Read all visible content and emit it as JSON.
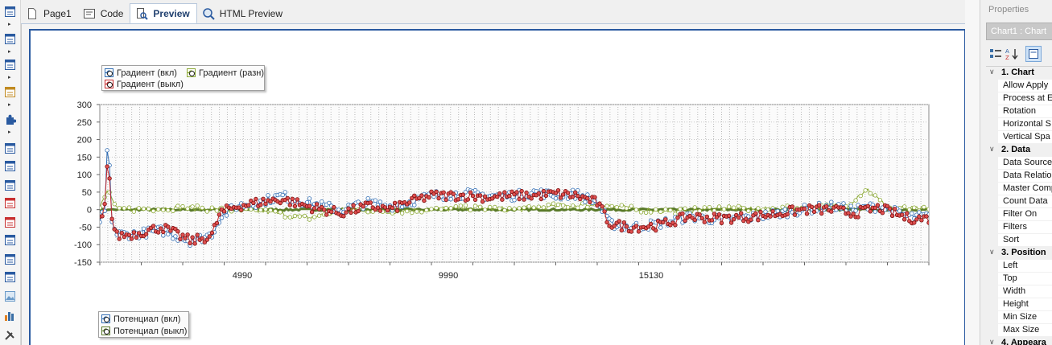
{
  "tabs": [
    {
      "label": "Page1",
      "icon": "page-icon",
      "active": false
    },
    {
      "label": "Code",
      "icon": "code-icon",
      "active": false
    },
    {
      "label": "Preview",
      "icon": "preview-icon",
      "active": true
    },
    {
      "label": "HTML Preview",
      "icon": "html-preview-icon",
      "active": false
    }
  ],
  "toolbox": {
    "icons": [
      "page-layout-icon",
      "data-band-icon",
      "table-band-icon",
      "chart-report-icon",
      "component-icon",
      "text-icon",
      "rich-text-icon",
      "barcode-icon",
      "text-box-icon",
      "header-band-icon",
      "footer-band-icon",
      "crosstab-icon",
      "text-format-icon",
      "image-icon",
      "bar-chart-icon",
      "tools-icon"
    ]
  },
  "properties": {
    "title": "Properties",
    "object": "Chart1 : Chart",
    "toolbar_icons": [
      "categorized-icon",
      "alphabetical-icon",
      "property-pages-icon"
    ],
    "groups": [
      {
        "label": "1. Chart",
        "items": [
          "Allow Apply",
          "Process at E",
          "Rotation",
          "Horizontal S",
          "Vertical Spa"
        ]
      },
      {
        "label": "2. Data",
        "items": [
          "Data Source",
          "Data Relation",
          "Master Comp",
          "Count Data",
          "Filter On",
          "Filters",
          "Sort"
        ]
      },
      {
        "label": "3. Position",
        "items": [
          "Left",
          "Top",
          "Width",
          "Height",
          "Min Size",
          "Max Size"
        ]
      },
      {
        "label": "4. Appeara",
        "items": []
      }
    ]
  },
  "chart_data": {
    "type": "line",
    "x_ticks": [
      "4990",
      "9990",
      "15130"
    ],
    "ylim": [
      -150,
      300
    ],
    "y_ticks": [
      "300",
      "250",
      "200",
      "150",
      "100",
      "50",
      "0",
      "-50",
      "-100",
      "-150"
    ],
    "grid": true,
    "legend_top": [
      "Градиент (вкл)",
      "Градиент (разн)",
      "Градиент (выкл)"
    ],
    "legend_bottom": [
      "Потенциал (вкл)",
      "Потенциал (выкл)"
    ],
    "series": [
      {
        "name": "Градиент (вкл)",
        "color": "#2f6cb3",
        "points": [
          [
            0,
            -40
          ],
          [
            130,
            10
          ],
          [
            200,
            250
          ],
          [
            280,
            -30
          ],
          [
            400,
            -70
          ],
          [
            800,
            -70
          ],
          [
            1500,
            -60
          ],
          [
            2200,
            -90
          ],
          [
            2700,
            -70
          ],
          [
            2900,
            -20
          ],
          [
            3300,
            10
          ],
          [
            3800,
            20
          ],
          [
            4400,
            40
          ],
          [
            5000,
            20
          ],
          [
            5800,
            0
          ],
          [
            6500,
            20
          ],
          [
            7000,
            10
          ],
          [
            7400,
            20
          ],
          [
            8000,
            40
          ],
          [
            8800,
            45
          ],
          [
            9400,
            40
          ],
          [
            10000,
            40
          ],
          [
            10500,
            50
          ],
          [
            11000,
            40
          ],
          [
            11500,
            45
          ],
          [
            12000,
            20
          ],
          [
            12300,
            -40
          ],
          [
            12800,
            -50
          ],
          [
            13500,
            -40
          ],
          [
            14200,
            -20
          ],
          [
            15000,
            -30
          ],
          [
            15800,
            -20
          ],
          [
            16400,
            -10
          ],
          [
            17000,
            0
          ],
          [
            17600,
            10
          ],
          [
            18200,
            0
          ],
          [
            18800,
            10
          ],
          [
            19500,
            -20
          ],
          [
            20000,
            -20
          ]
        ]
      },
      {
        "name": "Градиент (выкл)",
        "color": "#c8282a",
        "points": [
          [
            0,
            -30
          ],
          [
            130,
            20
          ],
          [
            200,
            175
          ],
          [
            280,
            -20
          ],
          [
            400,
            -75
          ],
          [
            800,
            -70
          ],
          [
            1500,
            -50
          ],
          [
            2200,
            -90
          ],
          [
            2700,
            -75
          ],
          [
            2900,
            -10
          ],
          [
            3300,
            10
          ],
          [
            3800,
            20
          ],
          [
            4400,
            30
          ],
          [
            5000,
            10
          ],
          [
            5800,
            -10
          ],
          [
            6500,
            10
          ],
          [
            7000,
            0
          ],
          [
            7400,
            20
          ],
          [
            8000,
            40
          ],
          [
            8800,
            40
          ],
          [
            9400,
            35
          ],
          [
            10000,
            40
          ],
          [
            10500,
            40
          ],
          [
            11000,
            45
          ],
          [
            11500,
            40
          ],
          [
            12000,
            20
          ],
          [
            12300,
            -40
          ],
          [
            12800,
            -50
          ],
          [
            13500,
            -45
          ],
          [
            14200,
            -20
          ],
          [
            15000,
            -25
          ],
          [
            15800,
            -20
          ],
          [
            16400,
            -10
          ],
          [
            17000,
            0
          ],
          [
            17600,
            0
          ],
          [
            18200,
            -10
          ],
          [
            18800,
            5
          ],
          [
            19500,
            -25
          ],
          [
            20000,
            -25
          ]
        ]
      },
      {
        "name": "Градиент (разн)",
        "color": "#8aa832",
        "points": [
          [
            0,
            5
          ],
          [
            200,
            60
          ],
          [
            400,
            0
          ],
          [
            2000,
            5
          ],
          [
            3000,
            0
          ],
          [
            4000,
            -5
          ],
          [
            5000,
            -25
          ],
          [
            6000,
            0
          ],
          [
            7000,
            -5
          ],
          [
            8000,
            0
          ],
          [
            9000,
            5
          ],
          [
            10000,
            0
          ],
          [
            11000,
            10
          ],
          [
            12000,
            15
          ],
          [
            13000,
            0
          ],
          [
            14000,
            -5
          ],
          [
            15000,
            5
          ],
          [
            16000,
            0
          ],
          [
            17000,
            5
          ],
          [
            18000,
            10
          ],
          [
            18500,
            60
          ],
          [
            19000,
            5
          ],
          [
            20000,
            0
          ]
        ]
      },
      {
        "name": "Потенциал (выкл)",
        "color": "#5a7a2a",
        "points": [
          [
            0,
            0
          ],
          [
            5000,
            0
          ],
          [
            10000,
            0
          ],
          [
            15000,
            0
          ],
          [
            20000,
            0
          ]
        ]
      }
    ]
  }
}
